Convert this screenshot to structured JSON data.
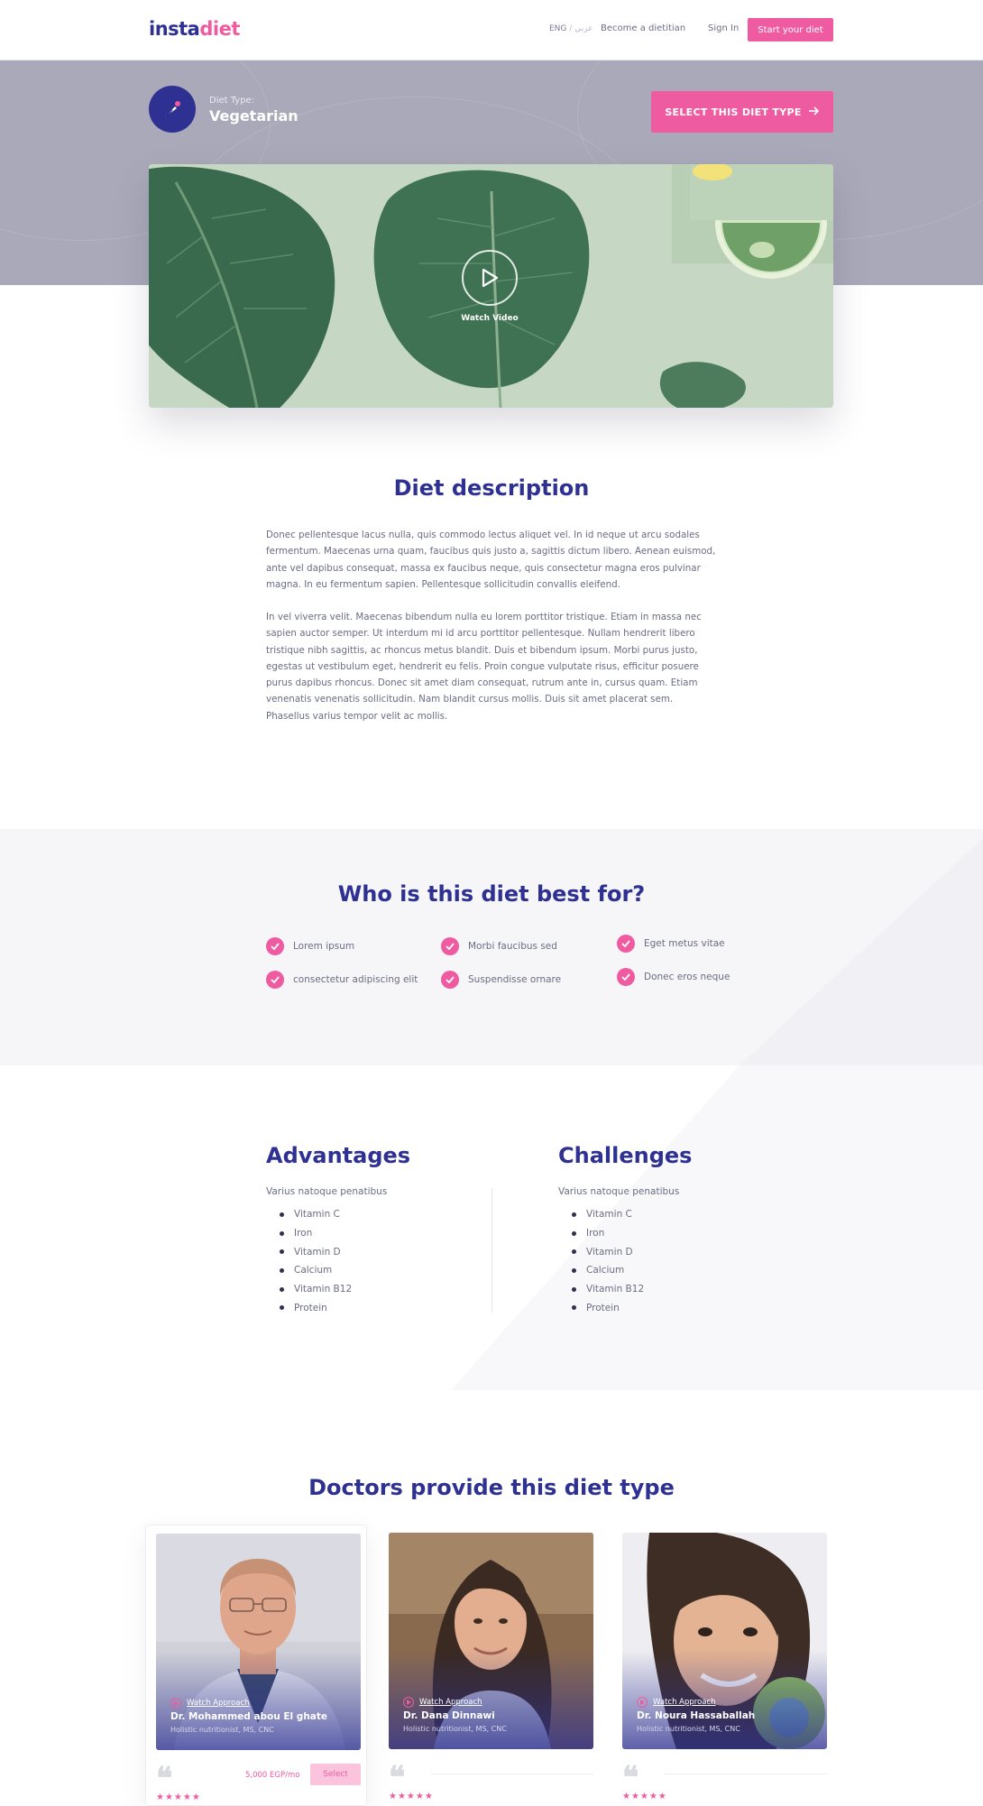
{
  "nav": {
    "logo_part1": "insta",
    "logo_part2": "diet",
    "lang_en": "ENG",
    "lang_sep": "/",
    "lang_ar": "عربي",
    "become": "Become a dietitian",
    "signin": "Sign In",
    "cta": "Start your diet"
  },
  "hero": {
    "diet_label": "Diet Type:",
    "diet_value": "Vegetarian",
    "select_label": "SELECT THIS DIET TYPE",
    "watch_video": "Watch Video"
  },
  "description": {
    "title": "Diet description",
    "p1": " Donec pellentesque lacus nulla, quis commodo lectus aliquet vel. In id neque ut arcu sodales fermentum. Maecenas urna quam, faucibus quis justo a, sagittis dictum libero. Aenean euismod, ante vel dapibus consequat, massa ex faucibus neque, quis consectetur magna eros pulvinar magna. In eu fermentum sapien. Pellentesque sollicitudin convallis eleifend.",
    "p2": "In vel viverra velit. Maecenas bibendum nulla eu lorem porttitor tristique. Etiam in massa nec sapien auctor semper. Ut interdum mi id arcu porttitor pellentesque. Nullam hendrerit libero tristique nibh sagittis, ac rhoncus metus blandit. Duis et bibendum ipsum. Morbi purus justo, egestas ut vestibulum eget, hendrerit eu felis. Proin congue vulputate risus, efficitur posuere purus dapibus rhoncus. Donec sit amet diam consequat, rutrum ante in, cursus quam. Etiam venenatis venenatis sollicitudin. Nam blandit cursus mollis. Duis sit amet placerat sem. Phasellus varius tempor velit ac mollis."
  },
  "best_for": {
    "title": "Who is this diet best for?",
    "items": [
      "Lorem ipsum",
      "consectetur adipiscing elit",
      "Morbi faucibus sed",
      "Suspendisse ornare",
      "Eget metus vitae",
      "Donec eros neque"
    ]
  },
  "advantages": {
    "title": "Advantages",
    "sub": "Varius natoque penatibus",
    "items": [
      "Vitamin C",
      "Iron",
      "Vitamin D",
      "Calcium",
      "Vitamin B12",
      "Protein"
    ]
  },
  "challenges": {
    "title": "Challenges",
    "sub": "Varius natoque penatibus",
    "items": [
      "Vitamin C",
      "Iron",
      "Vitamin D",
      "Calcium",
      "Vitamin B12",
      "Protein"
    ]
  },
  "doctors": {
    "title": "Doctors provide this diet type",
    "watch_label": "Watch Approach",
    "list": [
      {
        "name": "Dr. Mohammed abou El ghate",
        "title": "Holistic nutritionist, MS, CNC",
        "price": "5,000 EGP/mo",
        "select": "Select"
      },
      {
        "name": "Dr. Dana Dinnawi",
        "title": "Holistic nutritionist, MS, CNC"
      },
      {
        "name": "Dr. Noura Hassaballah",
        "title": "Holistic nutritionist, MS, CNC"
      }
    ],
    "quote_mark": "❝",
    "stars": "★★★★★"
  },
  "colors": {
    "brand_navy": "#2e3192",
    "brand_pink": "#ef5ba1",
    "hero_band": "#a9a9b9"
  }
}
